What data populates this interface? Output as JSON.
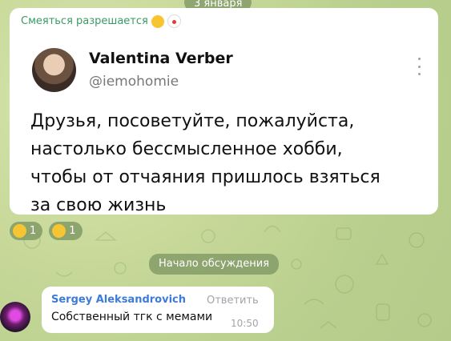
{
  "date_separator": "3 января",
  "post": {
    "forward_label": "Смеяться разрешается",
    "forward_emojis": [
      "grinning-emoji",
      "clown-emoji"
    ],
    "tweet": {
      "author_name": "Valentina Verber",
      "author_handle": "@iemohomie",
      "text": "Друзья, посоветуйте, пожалуйста,\nнастолько бессмысленное хобби,\nчтобы от отчаяния пришлось взяться\nза свою жизнь"
    },
    "reactions": [
      {
        "icon": "grinning-emoji",
        "count": "1"
      },
      {
        "icon": "rofl-emoji",
        "count": "1"
      }
    ]
  },
  "discussion_separator": "Начало обсуждения",
  "comment": {
    "author": "Sergey Aleksandrovich",
    "reply_label": "Ответить",
    "text": "Собственный тгк с мемами",
    "time": "10:50"
  },
  "colors": {
    "background": "#c8d99a",
    "forward_label": "#3a9a63",
    "comment_author": "#3d7bd6",
    "pill": "#789160"
  }
}
